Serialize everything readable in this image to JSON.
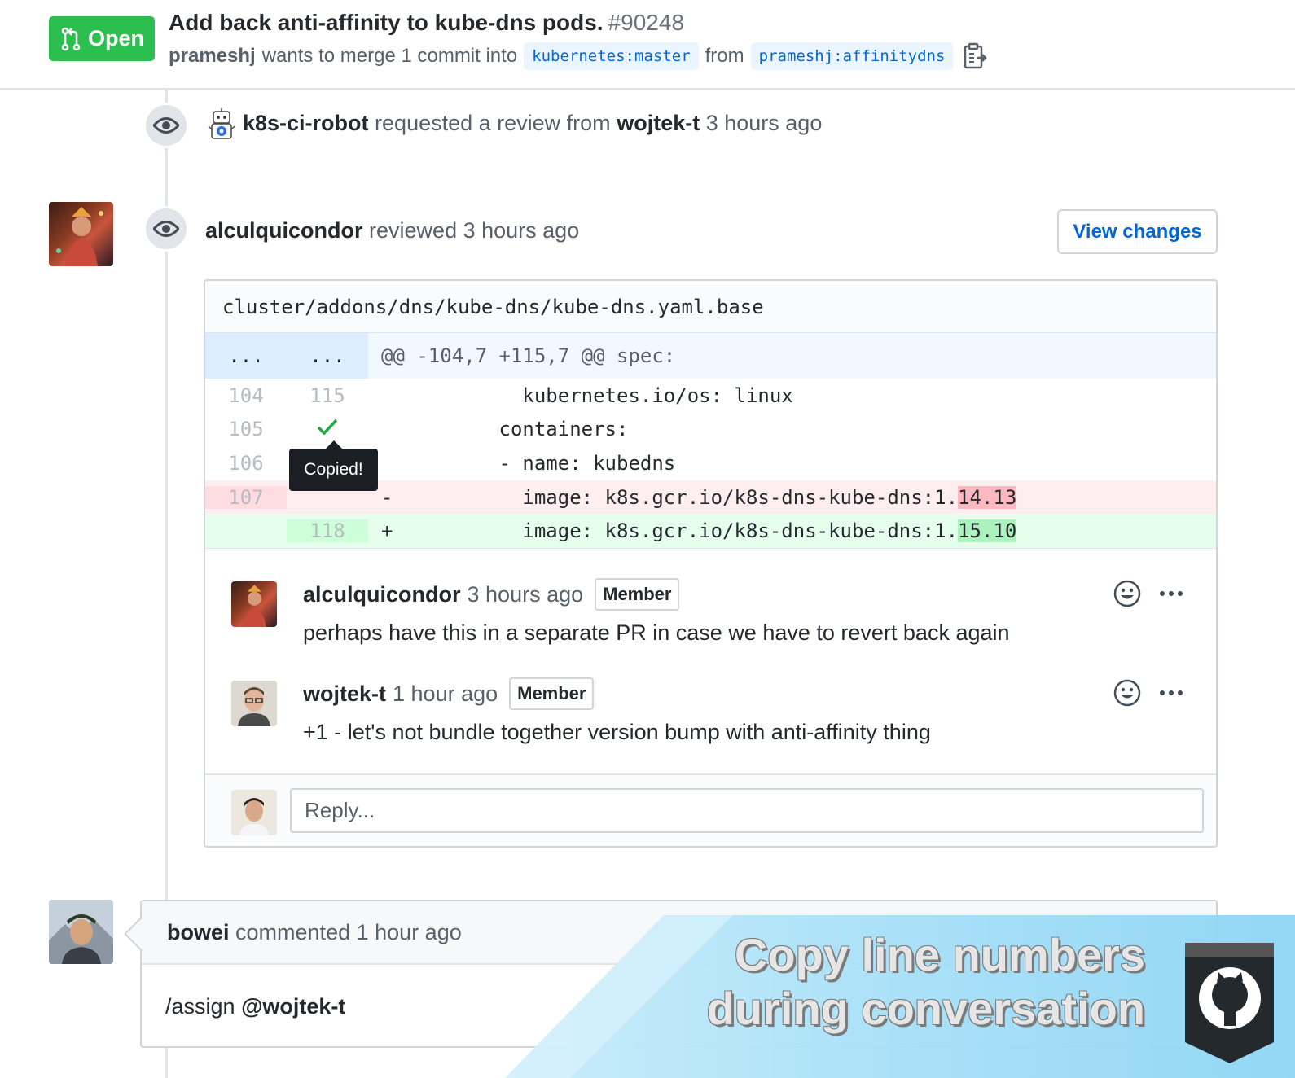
{
  "pr": {
    "state_label": "Open",
    "title": "Add back anti-affinity to kube-dns pods.",
    "number": "#90248",
    "author": "prameshj",
    "merge_text": "wants to merge 1 commit into",
    "base_branch": "kubernetes:master",
    "from_text": "from",
    "head_branch": "prameshj:affinitydns"
  },
  "events": {
    "review_request": {
      "actor": "k8s-ci-robot",
      "action": "requested a review from",
      "target": "wojtek-t",
      "time": "3 hours ago"
    },
    "review": {
      "actor": "alculquicondor",
      "action": "reviewed",
      "time": "3 hours ago",
      "view_changes_label": "View changes"
    }
  },
  "diff": {
    "file_path": "cluster/addons/dns/kube-dns/kube-dns.yaml.base",
    "hunk": {
      "old": "...",
      "new": "...",
      "header": "@@ -104,7 +115,7 @@ spec:"
    },
    "lines": [
      {
        "old": "104",
        "new": "115",
        "sign": " ",
        "code": "        kubernetes.io/os: linux"
      },
      {
        "old": "105",
        "new": "",
        "sign": " ",
        "code": "      containers:"
      },
      {
        "old": "106",
        "new": "",
        "sign": " ",
        "code": "      - name: kubedns"
      },
      {
        "old": "107",
        "new": "",
        "sign": "-",
        "code_prefix": "        image: k8s.gcr.io/k8s-dns-kube-dns:1.",
        "code_hl": "14.13"
      },
      {
        "old": "",
        "new": "118",
        "sign": "+",
        "code_prefix": "        image: k8s.gcr.io/k8s-dns-kube-dns:1.",
        "code_hl": "15.10"
      }
    ],
    "tooltip": "Copied!"
  },
  "comments": [
    {
      "author": "alculquicondor",
      "time": "3 hours ago",
      "badge": "Member",
      "body": "perhaps have this in a separate PR in case we have to revert back again"
    },
    {
      "author": "wojtek-t",
      "time": "1 hour ago",
      "badge": "Member",
      "body": "+1 - let's not bundle together version bump with anti-affinity thing"
    }
  ],
  "reply": {
    "placeholder": "Reply..."
  },
  "bottom_comment": {
    "author": "bowei",
    "action": "commented",
    "time": "1 hour ago",
    "body_prefix": "/assign ",
    "mention": "@wojtek-t"
  },
  "banner": {
    "line1": "Copy line numbers",
    "line2": "during conversation"
  },
  "colors": {
    "open_green": "#2cbe4e",
    "link_blue": "#0366d6",
    "banner_blue": "#a6dff7"
  }
}
